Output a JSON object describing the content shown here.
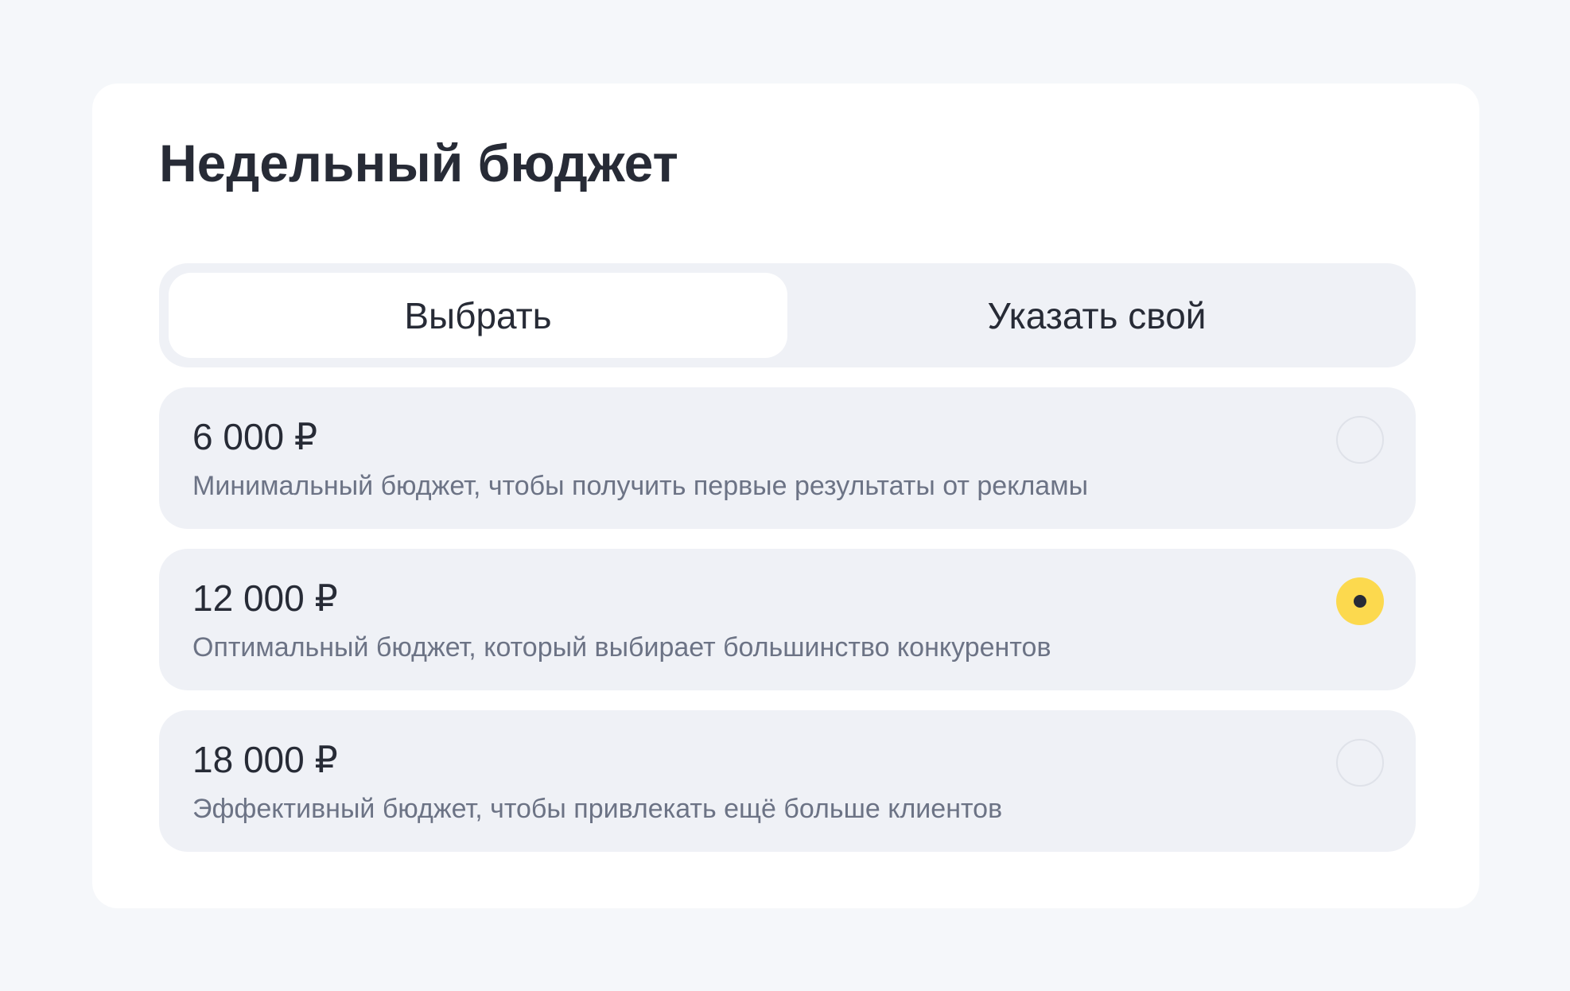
{
  "page": {
    "title": "Недельный бюджет"
  },
  "tabs": [
    {
      "label": "Выбрать",
      "active": true
    },
    {
      "label": "Указать свой",
      "active": false
    }
  ],
  "options": [
    {
      "price": "6 000 ₽",
      "description": "Минимальный бюджет, чтобы получить первые результаты от рекламы",
      "selected": false
    },
    {
      "price": "12 000 ₽",
      "description": "Оптимальный бюджет, который выбирает большинство конкурентов",
      "selected": true
    },
    {
      "price": "18 000 ₽",
      "description": "Эффективный бюджет, чтобы привлекать ещё больше клиентов",
      "selected": false
    }
  ],
  "colors": {
    "background": "#f5f7fa",
    "card": "#ffffff",
    "option_bg": "#eff1f6",
    "accent": "#fcd94e",
    "text_primary": "#272b36",
    "text_secondary": "#6c7385"
  },
  "icons": {
    "radio_unchecked": "radio-unchecked-icon",
    "radio_checked": "radio-checked-icon"
  }
}
